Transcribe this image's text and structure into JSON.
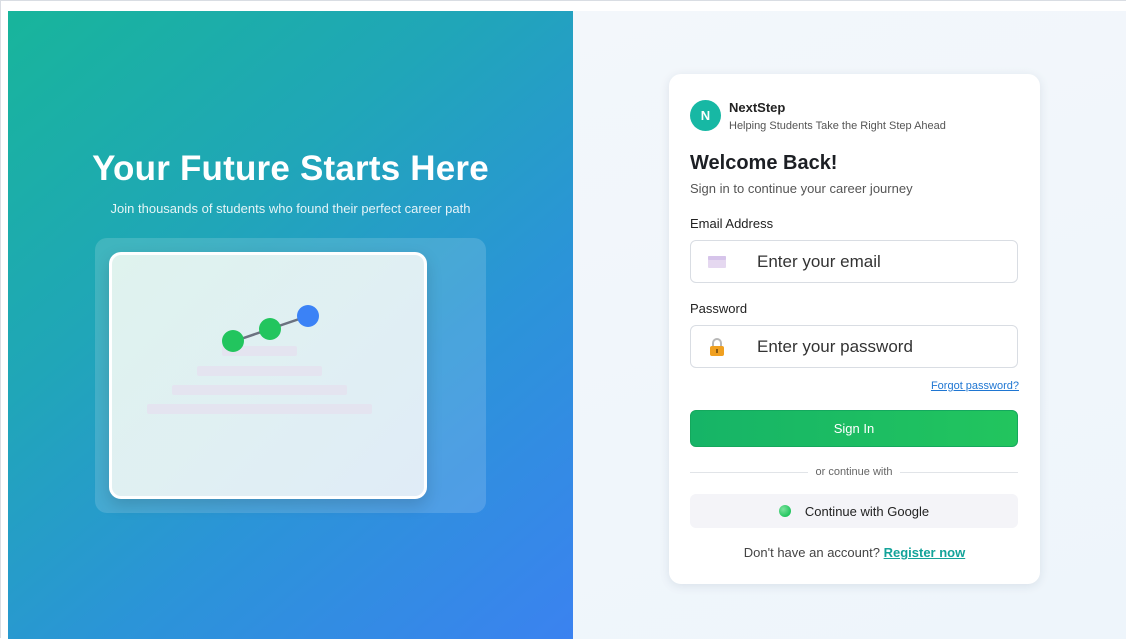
{
  "hero": {
    "title": "Your Future Starts Here",
    "subtitle": "Join thousands of students who found their perfect career path"
  },
  "brand": {
    "logo_letter": "N",
    "name": "NextStep",
    "tagline": "Helping Students Take the Right Step Ahead"
  },
  "login": {
    "heading": "Welcome Back!",
    "subheading": "Sign in to continue your career journey",
    "email_label": "Email Address",
    "email_placeholder": "Enter your email",
    "email_icon": "envelope-icon",
    "password_label": "Password",
    "password_placeholder": "Enter your password",
    "password_icon": "lock-icon",
    "forgot_label": "Forgot password?",
    "signin_label": "Sign In",
    "divider_text": "or continue with",
    "google_label": "Continue with Google",
    "register_prompt": "Don't have an account?",
    "register_link": "Register now"
  },
  "colors": {
    "accent_teal": "#17b8a4",
    "accent_green": "#22c55e",
    "accent_blue": "#3b82f6",
    "link_blue": "#1f76d2"
  }
}
